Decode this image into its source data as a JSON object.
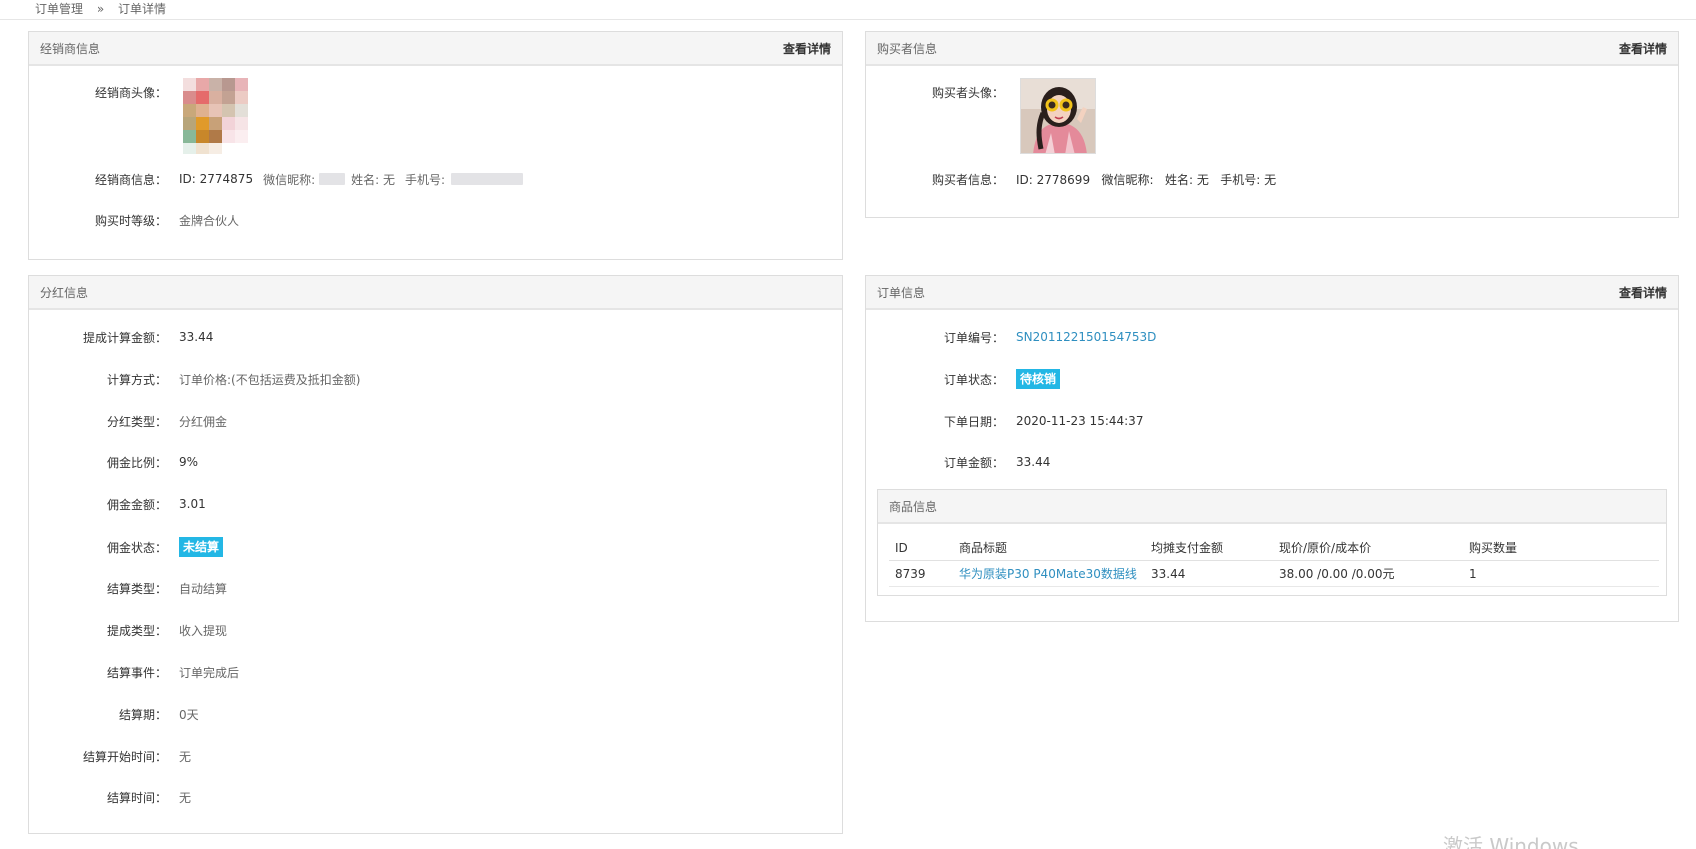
{
  "breadcrumb": {
    "level1": "订单管理",
    "separator": "»",
    "level2": "订单详情"
  },
  "dealer": {
    "title": "经销商信息",
    "link": "查看详情",
    "avatar_label": "经销商头像：",
    "info_label": "经销商信息：",
    "info_id": "ID: 2774875",
    "info_wechat": "微信昵称:",
    "info_name": "姓名: 无",
    "info_phone": "手机号:",
    "level_label": "购买时等级：",
    "level_value": "金牌合伙人"
  },
  "buyer": {
    "title": "购买者信息",
    "link": "查看详情",
    "avatar_label": "购买者头像：",
    "info_label": "购买者信息：",
    "info_value": "ID: 2778699   微信昵称:   姓名: 无   手机号: 无"
  },
  "dividend": {
    "title": "分红信息",
    "rows": [
      {
        "label": "提成计算金额：",
        "value": "33.44"
      },
      {
        "label": "计算方式：",
        "value": "订单价格:(不包括运费及抵扣金额)"
      },
      {
        "label": "分红类型：",
        "value": "分红佣金"
      },
      {
        "label": "佣金比例：",
        "value": "9%"
      },
      {
        "label": "佣金金额：",
        "value": "3.01"
      },
      {
        "label": "佣金状态：",
        "value": "未结算"
      },
      {
        "label": "结算类型：",
        "value": "自动结算"
      },
      {
        "label": "提成类型：",
        "value": "收入提现"
      },
      {
        "label": "结算事件：",
        "value": "订单完成后"
      },
      {
        "label": "结算期：",
        "value": "0天"
      },
      {
        "label": "结算开始时间：",
        "value": "无"
      },
      {
        "label": "结算时间：",
        "value": "无"
      }
    ]
  },
  "order": {
    "title": "订单信息",
    "link": "查看详情",
    "sn_label": "订单编号：",
    "sn_value": "SN201122150154753D",
    "status_label": "订单状态：",
    "status_value": "待核销",
    "date_label": "下单日期：",
    "date_value": "2020-11-23 15:44:37",
    "amount_label": "订单金额：",
    "amount_value": "33.44",
    "goods": {
      "title": "商品信息",
      "headers": [
        "ID",
        "商品标题",
        "均摊支付金额",
        "现价/原价/成本价",
        "购买数量"
      ],
      "rows": [
        [
          "8739",
          "华为原装P30 P40Mate30数据线",
          "33.44",
          "38.00 /0.00 /0.00元",
          "1"
        ]
      ]
    }
  },
  "watermark": "激活 Windows",
  "colors": {
    "badge": "#23b7e5",
    "link": "#2f8fc0",
    "panel_head": "#f5f5f5"
  }
}
